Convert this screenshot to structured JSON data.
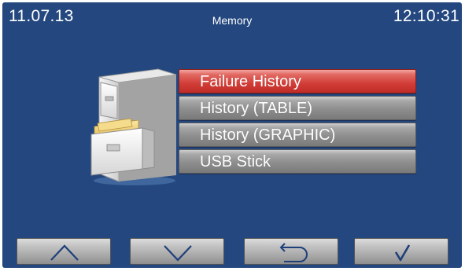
{
  "status_bar": {
    "date": "11.07.13",
    "title": "Memory",
    "time": "12:10:31"
  },
  "menu": {
    "items": [
      {
        "label": "Failure History",
        "selected": true
      },
      {
        "label": "History (TABLE)",
        "selected": false
      },
      {
        "label": "History (GRAPHIC)",
        "selected": false
      },
      {
        "label": "USB Stick",
        "selected": false
      }
    ]
  },
  "icons": {
    "illustration": "file-cabinet-icon",
    "nav": [
      "chevron-up-icon",
      "chevron-down-icon",
      "return-arrow-icon",
      "checkmark-icon"
    ]
  },
  "colors": {
    "background": "#23477e",
    "selected_item": "#d23d37",
    "item": "#8e8e8e",
    "text": "#ffffff"
  }
}
